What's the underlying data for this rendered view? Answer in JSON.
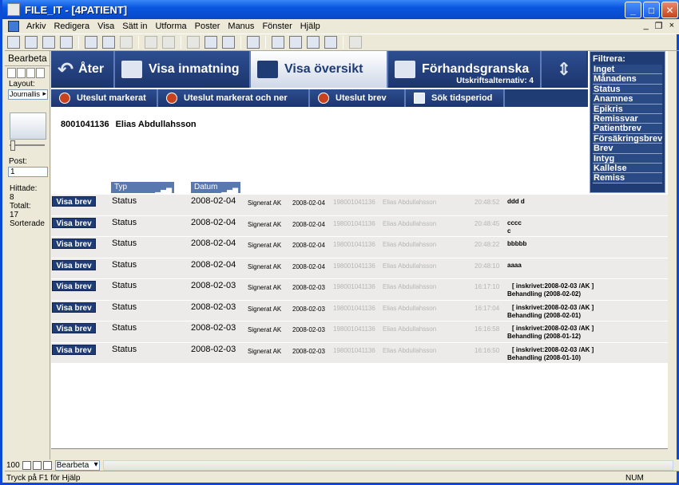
{
  "window": {
    "title": "FILE_IT - [4PATIENT]"
  },
  "menu": [
    "Arkiv",
    "Redigera",
    "Visa",
    "Sätt in",
    "Utforma",
    "Poster",
    "Manus",
    "Fönster",
    "Hjälp"
  ],
  "mdi": {
    "minimize": "_",
    "restore": "❐",
    "close": "×"
  },
  "left": {
    "title": "Bearbeta",
    "layout_label": "Layout:",
    "layout_value": "Journallis",
    "post_label": "Post:",
    "post_value": "1",
    "found_label": "Hittade:",
    "found_value": "8",
    "total_label": "Totalt:",
    "total_value": "17",
    "sorted_label": "Sorterade"
  },
  "nav": {
    "back": "Åter",
    "input": "Visa inmatning",
    "overview": "Visa översikt",
    "preview": "Förhandsgranska",
    "print_options": "Utskriftsalternativ: 4"
  },
  "filter": {
    "title": "Filtrera:",
    "items": [
      "Inget",
      "Månadens",
      "Status",
      "Anamnes",
      "Epikris",
      "Remissvar",
      "Patientbrev",
      "Försäkringsbrev",
      "Brev",
      "Intyg",
      "Kallelse",
      "Remiss"
    ]
  },
  "actions": {
    "exclude_marked": "Uteslut markerat",
    "exclude_marked_down": "Uteslut markerat och ner",
    "exclude_letter": "Uteslut brev",
    "search_period": "Sök tidsperiod"
  },
  "patient": {
    "id": "8001041136",
    "name": "Elias Abdullahsson"
  },
  "columns": {
    "type": "Typ",
    "date": "Datum"
  },
  "rows": [
    {
      "btn": "Visa brev",
      "type": "Status",
      "date": "2008-02-04",
      "signed": "Signerat AK",
      "date2": "2008-02-04",
      "pid": "198001041136",
      "pname": "Elias Abdullahsson",
      "time": "20:48:52",
      "note1": "ddd d",
      "note2": ""
    },
    {
      "btn": "Visa brev",
      "type": "Status",
      "date": "2008-02-04",
      "signed": "Signerat AK",
      "date2": "2008-02-04",
      "pid": "198001041136",
      "pname": "Elias Abdullahsson",
      "time": "20:48:45",
      "note1": "cccc",
      "note2": "c"
    },
    {
      "btn": "Visa brev",
      "type": "Status",
      "date": "2008-02-04",
      "signed": "Signerat AK",
      "date2": "2008-02-04",
      "pid": "198001041136",
      "pname": "Elias Abdullahsson",
      "time": "20:48:22",
      "note1": "bbbbb",
      "note2": ""
    },
    {
      "btn": "Visa brev",
      "type": "Status",
      "date": "2008-02-04",
      "signed": "Signerat AK",
      "date2": "2008-02-04",
      "pid": "198001041136",
      "pname": "Elias Abdullahsson",
      "time": "20:48:10",
      "note1": "aaaa",
      "note2": ""
    },
    {
      "btn": "Visa brev",
      "type": "Status",
      "date": "2008-02-03",
      "signed": "Signerat AK",
      "date2": "2008-02-03",
      "pid": "198001041136",
      "pname": "Elias Abdullahsson",
      "time": "16:17:10",
      "note1": "[ inskrivet:2008-02-03 /AK ]",
      "note2": "Behandling (2008-02-02)"
    },
    {
      "btn": "Visa brev",
      "type": "Status",
      "date": "2008-02-03",
      "signed": "Signerat AK",
      "date2": "2008-02-03",
      "pid": "198001041136",
      "pname": "Elias Abdullahsson",
      "time": "16:17:04",
      "note1": "[ inskrivet:2008-02-03 /AK ]",
      "note2": "Behandling (2008-02-01)"
    },
    {
      "btn": "Visa brev",
      "type": "Status",
      "date": "2008-02-03",
      "signed": "Signerat AK",
      "date2": "2008-02-03",
      "pid": "198001041136",
      "pname": "Elias Abdullahsson",
      "time": "16:16:58",
      "note1": "[ inskrivet:2008-02-03 /AK ]",
      "note2": "Behandling (2008-01-12)"
    },
    {
      "btn": "Visa brev",
      "type": "Status",
      "date": "2008-02-03",
      "signed": "Signerat AK",
      "date2": "2008-02-03",
      "pid": "198001041136",
      "pname": "Elias Abdullahsson",
      "time": "16:16:50",
      "note1": "[ inskrivet:2008-02-03 /AK ]",
      "note2": "Behandling (2008-01-10)"
    }
  ],
  "bottom": {
    "zoom": "100",
    "mode": "Bearbeta"
  },
  "status": {
    "hint": "Tryck på F1 för Hjälp",
    "num": "NUM"
  }
}
